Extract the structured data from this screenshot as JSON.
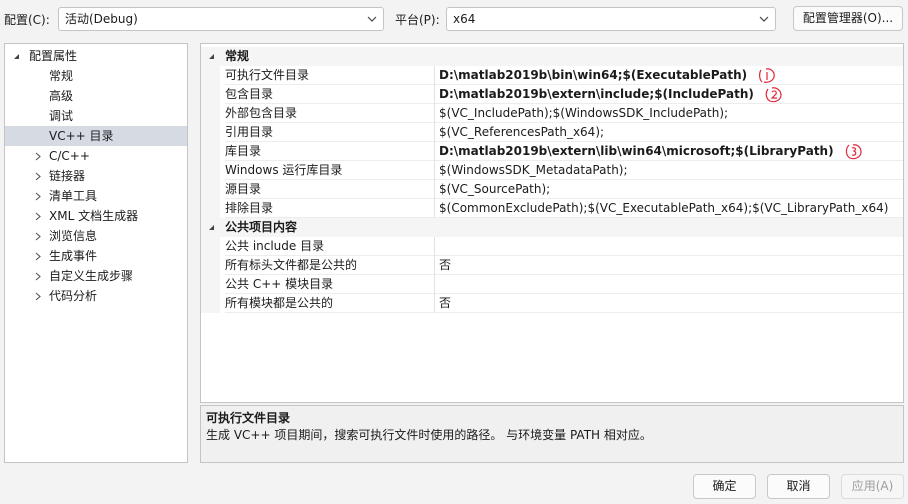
{
  "toolbar": {
    "config_label": "配置(C):",
    "config_value": "活动(Debug)",
    "platform_label": "平台(P):",
    "platform_value": "x64",
    "config_manager_button": "配置管理器(O)..."
  },
  "tree": {
    "items": [
      {
        "label": "配置属性",
        "level": 0,
        "expander": "expanded",
        "selected": false
      },
      {
        "label": "常规",
        "level": 1,
        "expander": "none",
        "selected": false
      },
      {
        "label": "高级",
        "level": 1,
        "expander": "none",
        "selected": false
      },
      {
        "label": "调试",
        "level": 1,
        "expander": "none",
        "selected": false
      },
      {
        "label": "VC++ 目录",
        "level": 1,
        "expander": "none",
        "selected": true
      },
      {
        "label": "C/C++",
        "level": 1,
        "expander": "collapsed",
        "selected": false
      },
      {
        "label": "链接器",
        "level": 1,
        "expander": "collapsed",
        "selected": false
      },
      {
        "label": "清单工具",
        "level": 1,
        "expander": "collapsed",
        "selected": false
      },
      {
        "label": "XML 文档生成器",
        "level": 1,
        "expander": "collapsed",
        "selected": false
      },
      {
        "label": "浏览信息",
        "level": 1,
        "expander": "collapsed",
        "selected": false
      },
      {
        "label": "生成事件",
        "level": 1,
        "expander": "collapsed",
        "selected": false
      },
      {
        "label": "自定义生成步骤",
        "level": 1,
        "expander": "collapsed",
        "selected": false
      },
      {
        "label": "代码分析",
        "level": 1,
        "expander": "collapsed",
        "selected": false
      }
    ]
  },
  "grid": {
    "categories": [
      {
        "name": "常规",
        "properties": [
          {
            "name": "可执行文件目录",
            "value": "D:\\matlab2019b\\bin\\win64;$(ExecutablePath)",
            "bold": true,
            "annotation": "1"
          },
          {
            "name": "包含目录",
            "value": "D:\\matlab2019b\\extern\\include;$(IncludePath)",
            "bold": true,
            "annotation": "2"
          },
          {
            "name": "外部包含目录",
            "value": "$(VC_IncludePath);$(WindowsSDK_IncludePath);",
            "bold": false,
            "annotation": ""
          },
          {
            "name": "引用目录",
            "value": "$(VC_ReferencesPath_x64);",
            "bold": false,
            "annotation": ""
          },
          {
            "name": "库目录",
            "value": "D:\\matlab2019b\\extern\\lib\\win64\\microsoft;$(LibraryPath)",
            "bold": true,
            "annotation": "3"
          },
          {
            "name": "Windows 运行库目录",
            "value": "$(WindowsSDK_MetadataPath);",
            "bold": false,
            "annotation": ""
          },
          {
            "name": "源目录",
            "value": "$(VC_SourcePath);",
            "bold": false,
            "annotation": ""
          },
          {
            "name": "排除目录",
            "value": "$(CommonExcludePath);$(VC_ExecutablePath_x64);$(VC_LibraryPath_x64)",
            "bold": false,
            "annotation": ""
          }
        ]
      },
      {
        "name": "公共项目内容",
        "properties": [
          {
            "name": "公共 include 目录",
            "value": "",
            "bold": false,
            "annotation": ""
          },
          {
            "name": "所有标头文件都是公共的",
            "value": "否",
            "bold": false,
            "annotation": ""
          },
          {
            "name": "公共 C++ 模块目录",
            "value": "",
            "bold": false,
            "annotation": ""
          },
          {
            "name": "所有模块都是公共的",
            "value": "否",
            "bold": false,
            "annotation": ""
          }
        ]
      }
    ]
  },
  "description": {
    "title": "可执行文件目录",
    "text": "生成 VC++ 项目期间，搜索可执行文件时使用的路径。 与环境变量 PATH 相对应。"
  },
  "buttons": {
    "ok": "确定",
    "cancel": "取消",
    "apply": "应用(A)"
  },
  "colors": {
    "selection": "#d6dbe3",
    "annotation_ink": "#e0283c",
    "window_bg": "#f3f3f3"
  }
}
